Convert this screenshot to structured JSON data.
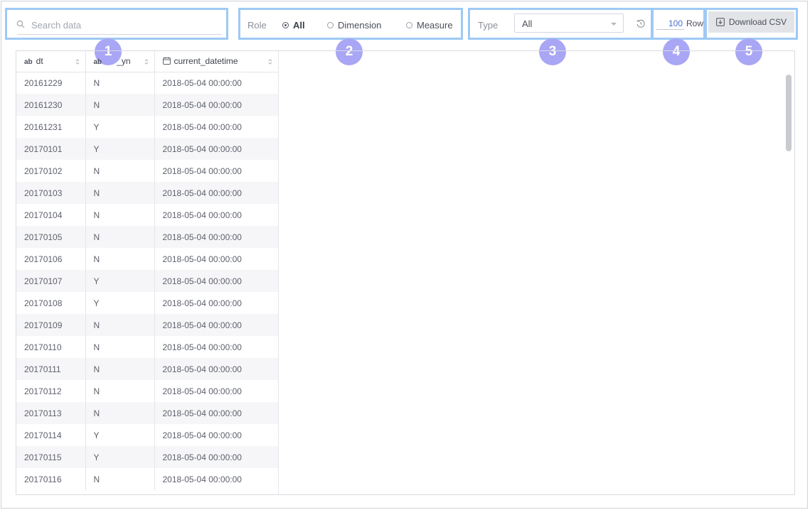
{
  "search": {
    "placeholder": "Search data",
    "value": ""
  },
  "role": {
    "label": "Role",
    "options": [
      {
        "label": "All",
        "selected": true
      },
      {
        "label": "Dimension",
        "selected": false
      },
      {
        "label": "Measure",
        "selected": false
      }
    ]
  },
  "type": {
    "label": "Type",
    "selected": "All"
  },
  "rows": {
    "value": "100",
    "label": "Row"
  },
  "download": {
    "label": "Download CSV",
    "icon": "download-icon"
  },
  "badges": [
    "1",
    "2",
    "3",
    "4",
    "5"
  ],
  "colors": {
    "highlight": "#9ec9f5",
    "badge": "#a9a6f5",
    "selected_text": "#4a6fd0",
    "button_bg": "#e3e4e8"
  },
  "table": {
    "columns": [
      {
        "type_icon": "ab",
        "name": "dt"
      },
      {
        "type_icon": "ab",
        "name": "_yn"
      },
      {
        "type_icon": "calendar-icon",
        "name": "current_datetime"
      }
    ],
    "rows": [
      [
        "20161229",
        "N",
        "2018-05-04 00:00:00"
      ],
      [
        "20161230",
        "N",
        "2018-05-04 00:00:00"
      ],
      [
        "20161231",
        "Y",
        "2018-05-04 00:00:00"
      ],
      [
        "20170101",
        "Y",
        "2018-05-04 00:00:00"
      ],
      [
        "20170102",
        "N",
        "2018-05-04 00:00:00"
      ],
      [
        "20170103",
        "N",
        "2018-05-04 00:00:00"
      ],
      [
        "20170104",
        "N",
        "2018-05-04 00:00:00"
      ],
      [
        "20170105",
        "N",
        "2018-05-04 00:00:00"
      ],
      [
        "20170106",
        "N",
        "2018-05-04 00:00:00"
      ],
      [
        "20170107",
        "Y",
        "2018-05-04 00:00:00"
      ],
      [
        "20170108",
        "Y",
        "2018-05-04 00:00:00"
      ],
      [
        "20170109",
        "N",
        "2018-05-04 00:00:00"
      ],
      [
        "20170110",
        "N",
        "2018-05-04 00:00:00"
      ],
      [
        "20170111",
        "N",
        "2018-05-04 00:00:00"
      ],
      [
        "20170112",
        "N",
        "2018-05-04 00:00:00"
      ],
      [
        "20170113",
        "N",
        "2018-05-04 00:00:00"
      ],
      [
        "20170114",
        "Y",
        "2018-05-04 00:00:00"
      ],
      [
        "20170115",
        "Y",
        "2018-05-04 00:00:00"
      ],
      [
        "20170116",
        "N",
        "2018-05-04 00:00:00"
      ]
    ]
  }
}
